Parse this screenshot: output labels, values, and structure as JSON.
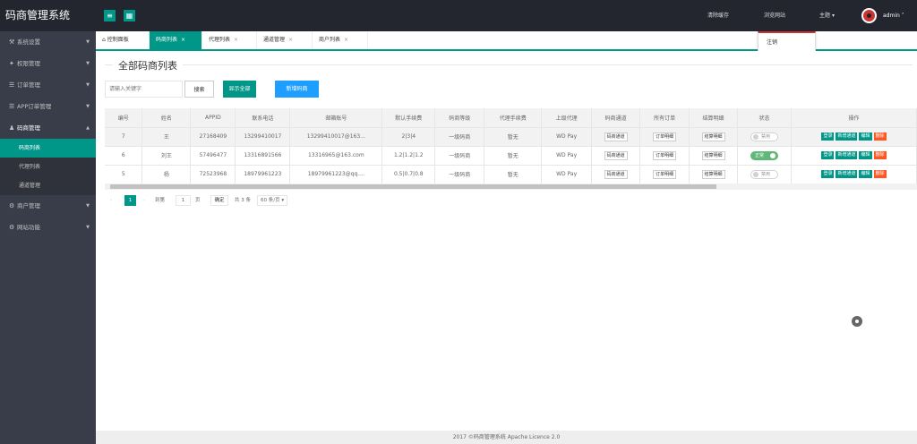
{
  "app": {
    "title": "码商管理系统"
  },
  "sidebar": {
    "items": [
      {
        "label": "系统设置",
        "icon": "wrench-icon",
        "glyph": "⚒"
      },
      {
        "label": "权限管理",
        "icon": "settings-icon",
        "glyph": "✦"
      },
      {
        "label": "订单管理",
        "icon": "list-icon",
        "glyph": "☰"
      },
      {
        "label": "APP订单管理",
        "icon": "list-icon",
        "glyph": "☰"
      },
      {
        "label": "码商管理",
        "icon": "user-icon",
        "glyph": "♟"
      },
      {
        "label": "商户管理",
        "icon": "gear-icon",
        "glyph": "⚙"
      },
      {
        "label": "网站功能",
        "icon": "gear-icon",
        "glyph": "⚙"
      }
    ],
    "sub_items": [
      {
        "label": "码商列表"
      },
      {
        "label": "代理列表"
      },
      {
        "label": "通道管理"
      }
    ]
  },
  "header": {
    "links": [
      "清除缓存",
      "浏览网站",
      "主题"
    ],
    "user": "admin",
    "dropdown_item": "注销"
  },
  "tabs": [
    {
      "label": "控制面板",
      "closable": false
    },
    {
      "label": "码商列表",
      "closable": true
    },
    {
      "label": "代理列表",
      "closable": true
    },
    {
      "label": "通道管理",
      "closable": true
    },
    {
      "label": "商户列表",
      "closable": true
    }
  ],
  "page": {
    "title": "全部码商列表",
    "search_placeholder": "请输入关键字",
    "search_label": "搜索",
    "show_all_label": "显示全部",
    "add_label": "新增码商"
  },
  "table": {
    "columns": [
      "编号",
      "姓名",
      "APPID",
      "联系电话",
      "邮箱账号",
      "默认手续费",
      "码商等级",
      "代理手续费",
      "上级代理",
      "码商通道",
      "所有订单",
      "结算明细",
      "状态",
      "操作"
    ],
    "rows": [
      {
        "id": "7",
        "name": "王",
        "appid": "27168409",
        "phone": "13299410017",
        "email": "13299410017@163...",
        "fee": "2|3|4",
        "level": "一级码商",
        "agent_fee": "暂无",
        "parent": "WD Pay",
        "channel_btn": "码商通道",
        "orders_btn": "订单明细",
        "settle_btn": "结算明细",
        "status": "禁用",
        "status_on": false
      },
      {
        "id": "6",
        "name": "刘王",
        "appid": "57496477",
        "phone": "13316891566",
        "email": "13316965@163.com",
        "fee": "1.2|1.2|1.2",
        "level": "一级码商",
        "agent_fee": "暂无",
        "parent": "WD Pay",
        "channel_btn": "码商通道",
        "orders_btn": "订单明细",
        "settle_btn": "结算明细",
        "status": "正常",
        "status_on": true
      },
      {
        "id": "5",
        "name": "杨",
        "appid": "72523968",
        "phone": "18979961223",
        "email": "18979961223@qq....",
        "fee": "0.5|0.7|0.8",
        "level": "一级码商",
        "agent_fee": "暂无",
        "parent": "WD Pay",
        "channel_btn": "码商通道",
        "orders_btn": "订单明细",
        "settle_btn": "结算明细",
        "status": "禁用",
        "status_on": false
      }
    ],
    "actions": [
      {
        "label": "登录",
        "color": "#009688"
      },
      {
        "label": "新增通道",
        "color": "#009688"
      },
      {
        "label": "编辑",
        "color": "#009688"
      },
      {
        "label": "删除",
        "color": "#ff5722"
      }
    ]
  },
  "pagination": {
    "prev": "‹",
    "current": "1",
    "next": "›",
    "goto_label": "到第",
    "goto_value": "1",
    "page_unit": "页",
    "confirm": "确定",
    "total": "共 3 条",
    "page_size": "60 条/页 ▾"
  },
  "footer": {
    "text": "2017 ©码商管理系统 Apache Licence 2.0"
  }
}
